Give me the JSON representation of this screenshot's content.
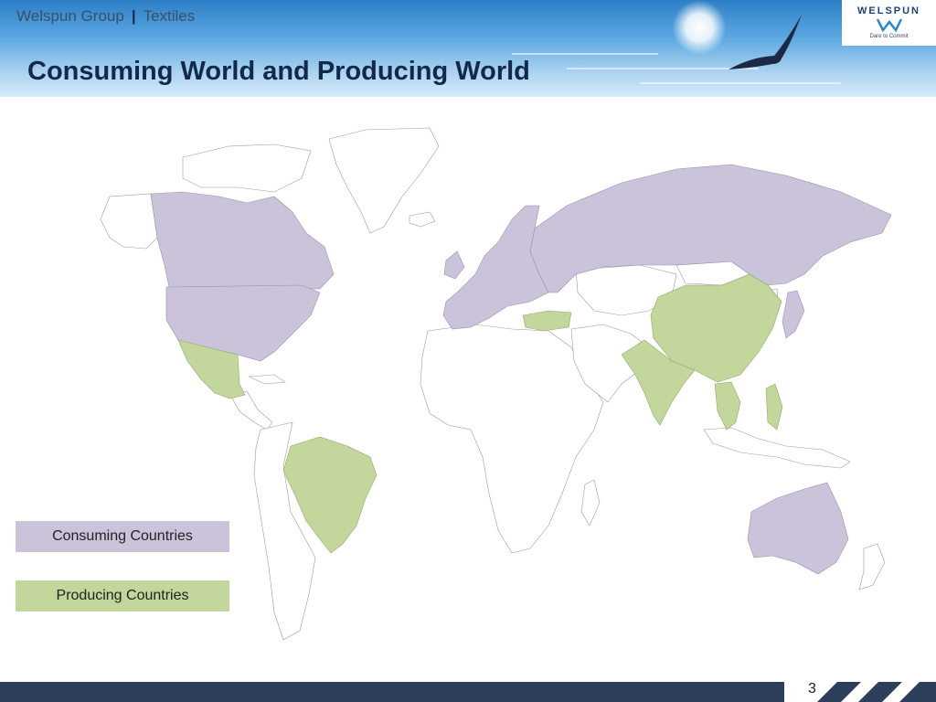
{
  "header": {
    "company": "Welspun Group",
    "section": "Textiles",
    "separator": "|",
    "title": "Consuming World and Producing World"
  },
  "logo": {
    "name": "WELSPUN",
    "tagline": "Dare to Commit"
  },
  "colors": {
    "consuming": "#cbc3da",
    "producing": "#c3d69b",
    "other": "#ffffff",
    "title": "#13294b",
    "footer": "#2d3d5c"
  },
  "map": {
    "consuming_regions": [
      "USA & Canada",
      "Europe",
      "Russia",
      "Australia",
      "Japan"
    ],
    "producing_regions": [
      "Mexico",
      "Brazil",
      "Turkey",
      "China",
      "India",
      "South-East Asia"
    ]
  },
  "legend": {
    "consuming": "Consuming Countries",
    "producing": "Producing Countries"
  },
  "footer": {
    "page_number": "3"
  }
}
